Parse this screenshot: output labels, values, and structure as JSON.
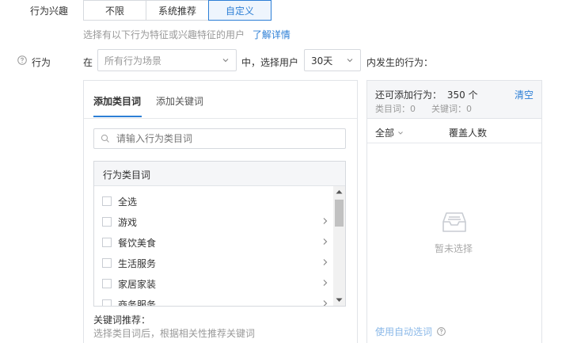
{
  "interest": {
    "label": "行为兴趣",
    "options": [
      "不限",
      "系统推荐",
      "自定义"
    ],
    "selected": "自定义",
    "hint": "选择有以下行为特征或兴趣特征的用户",
    "hint_link": "了解详情"
  },
  "behavior": {
    "label": "行为",
    "in_label": "在",
    "scene_placeholder": "所有行为场景",
    "mid_label": "中，选择用户",
    "days_value": "30天",
    "suffix": "内发生的行为："
  },
  "left_panel": {
    "tabs": [
      "添加类目词",
      "添加关键词"
    ],
    "active_tab": "添加类目词",
    "search_placeholder": "请输入行为类目词",
    "list_header": "行为类目词",
    "items": [
      "全选",
      "游戏",
      "餐饮美食",
      "生活服务",
      "家居家装",
      "商务服务"
    ],
    "kw_title": "关键词推荐：",
    "kw_desc": "选择类目词后，根据相关性推荐关键词"
  },
  "right_panel": {
    "remaining_label": "还可添加行为：",
    "remaining_value": "350 个",
    "clear": "清空",
    "category_count": "类目词：0",
    "keyword_count": "关键词：0",
    "col_all": "全部",
    "col_coverage": "覆盖人数",
    "empty_text": "暂未选择",
    "auto_select": "使用自动选词"
  },
  "colors": {
    "accent": "#2d7fd6",
    "border": "#d6d9de"
  }
}
